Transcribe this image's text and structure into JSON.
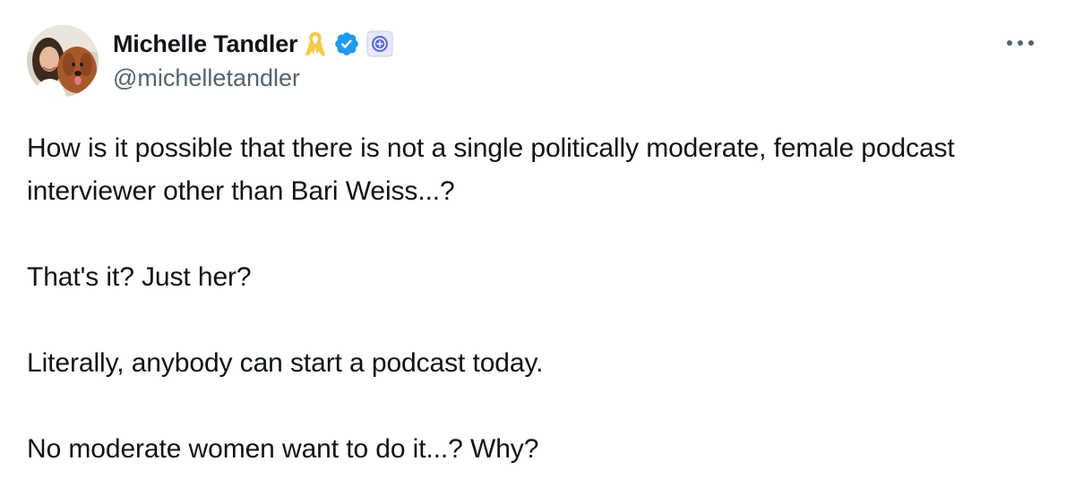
{
  "author": {
    "display_name": "Michelle Tandler",
    "handle": "@michelletandler",
    "badges": {
      "ribbon": {
        "icon": "yellow-ribbon-icon",
        "color": "#f7c948"
      },
      "verified": {
        "icon": "verified-check-icon",
        "color": "#1d9bf0"
      },
      "affiliate": {
        "icon": "affiliation-badge-icon",
        "color": "#5b6ee1"
      }
    }
  },
  "menu": {
    "icon": "more-horizontal-icon"
  },
  "tweet": {
    "paragraphs": [
      "How is it possible that there is not a single politically moderate, female podcast interviewer other than Bari Weiss...?",
      "That's it? Just her?",
      "Literally, anybody can start a podcast today.",
      "No moderate women want to do it...? Why?"
    ]
  }
}
